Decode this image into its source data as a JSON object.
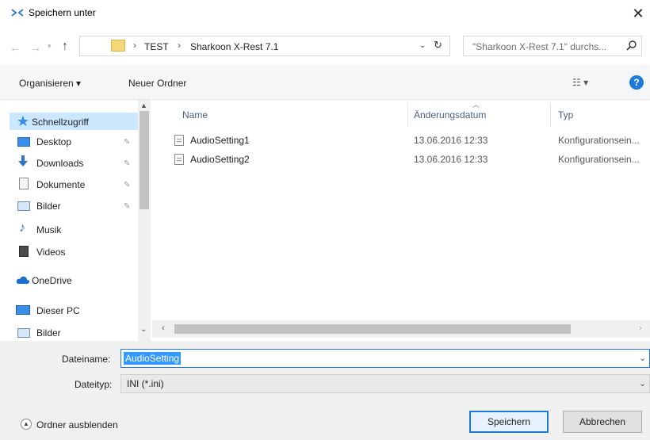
{
  "window": {
    "title": "Speichern unter",
    "close_glyph": "✕"
  },
  "address": {
    "breadcrumbs": [
      "TEST",
      "Sharkoon X-Rest 7.1"
    ],
    "separator": "›",
    "search_placeholder": "\"Sharkoon X-Rest 7.1\" durchs..."
  },
  "toolbar": {
    "organize_label": "Organisieren ▾",
    "new_folder_label": "Neuer Ordner",
    "view_glyph": "☷ ▾",
    "help_glyph": "?"
  },
  "navigation": {
    "items": [
      {
        "label": "Schnellzugriff",
        "icon": "star-icon"
      },
      {
        "label": "Desktop",
        "icon": "desktop-icon",
        "pinned": true
      },
      {
        "label": "Downloads",
        "icon": "download-icon",
        "pinned": true
      },
      {
        "label": "Dokumente",
        "icon": "document-icon",
        "pinned": true
      },
      {
        "label": "Bilder",
        "icon": "pictures-icon",
        "pinned": true
      },
      {
        "label": "Musik",
        "icon": "music-icon"
      },
      {
        "label": "Videos",
        "icon": "video-icon"
      },
      {
        "label": "OneDrive",
        "icon": "cloud-icon"
      },
      {
        "label": "Dieser PC",
        "icon": "computer-icon"
      },
      {
        "label": "Bilder",
        "icon": "pictures-icon"
      }
    ]
  },
  "file_list": {
    "columns": [
      "Name",
      "Änderungsdatum",
      "Typ"
    ],
    "rows": [
      {
        "name": "AudioSetting1",
        "date": "13.06.2016 12:33",
        "type": "Konfigurationsein..."
      },
      {
        "name": "AudioSetting2",
        "date": "13.06.2016 12:33",
        "type": "Konfigurationsein..."
      }
    ]
  },
  "form": {
    "filename_label": "Dateiname:",
    "filename_value": "AudioSetting",
    "filetype_label": "Dateityp:",
    "filetype_value": "INI (*.ini)"
  },
  "footer": {
    "hide_folders_label": "Ordner ausblenden",
    "save_label": "Speichern",
    "cancel_label": "Abbrechen"
  },
  "colors": {
    "accent": "#1e7ad8",
    "selection": "#cce8ff",
    "highlight": "#3399ff"
  }
}
